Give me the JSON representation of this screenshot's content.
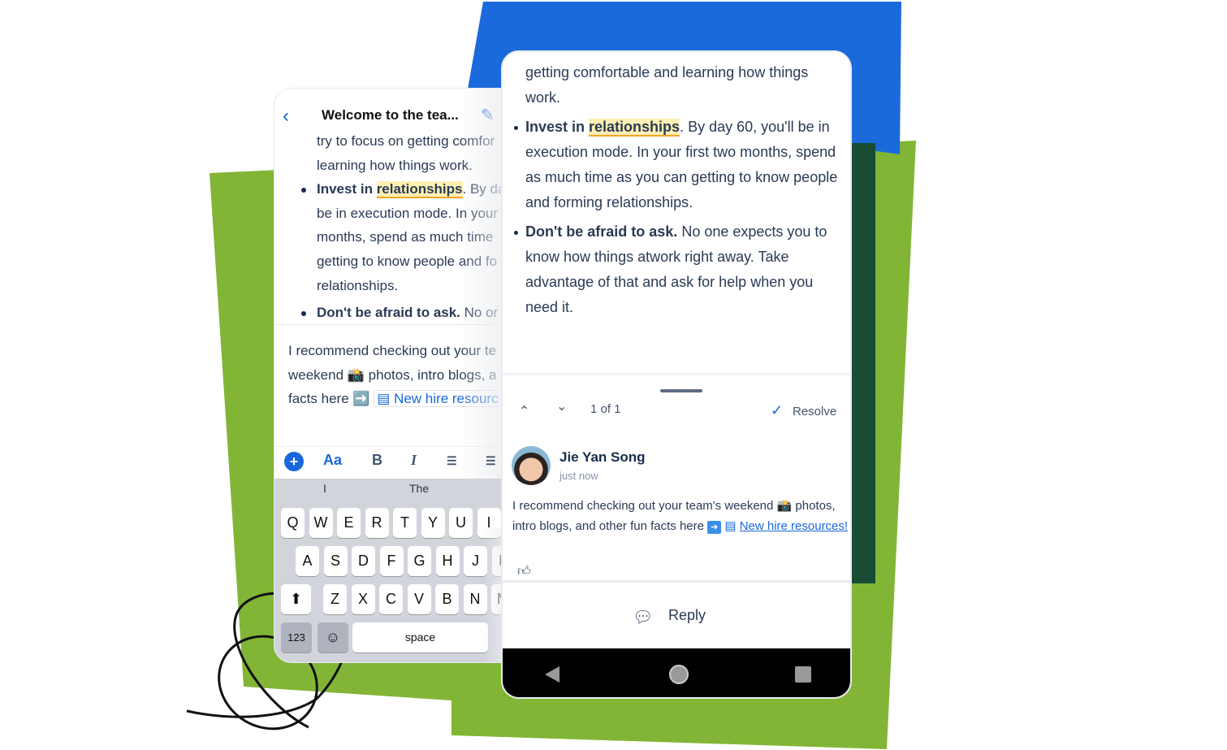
{
  "colors": {
    "blue": "#1a6adb",
    "green": "#82b536",
    "dark_green": "#174d35",
    "accent": "#1868db",
    "highlight": "#fff0b3"
  },
  "left_phone": {
    "header": {
      "title": "Welcome to the tea...",
      "back_icon": "chevron-left-icon",
      "edit_icon": "pencil-icon"
    },
    "doc": {
      "line1": "try to focus on getting comfor",
      "line2": "learning how things work.",
      "b1_bold": "Invest in ",
      "b1_hl": "relationships",
      "b1_rest": ". By da",
      "l3": "be in execution mode. In your",
      "l4": "months, spend as much time",
      "l5": "getting to know people and fo",
      "l6": "relationships.",
      "b2_bold": "Don't be afraid to ask.",
      "b2_rest": " No or"
    },
    "comment": {
      "line1": "I recommend checking out your te",
      "line2a": "weekend ",
      "line2b": " photos, intro blogs, a",
      "line3": "facts here ",
      "link": "New hire resourc"
    },
    "toolbar": {
      "add": "+",
      "text_style": "Aa",
      "bold": "B",
      "italic": "I",
      "bullet": "☰",
      "numbered": "☰"
    },
    "keyboard": {
      "suggestions": [
        "I",
        "The"
      ],
      "row1": [
        "Q",
        "W",
        "E",
        "R",
        "T",
        "Y",
        "U",
        "I"
      ],
      "row2": [
        "A",
        "S",
        "D",
        "F",
        "G",
        "H",
        "J",
        "K"
      ],
      "row3": [
        "Z",
        "X",
        "C",
        "V",
        "B",
        "N",
        "M"
      ],
      "numbers": "123",
      "space": "space"
    }
  },
  "right_phone": {
    "doc": {
      "l1": "getting comfortable and learning how things",
      "l2": "work.",
      "b1_bold": "Invest in ",
      "b1_hl": "relationships",
      "b1_rest": ". By day 60, you'll be in",
      "l3": "execution mode. In your first two months, spend",
      "l4": "as much time as you can getting to know people",
      "l5": "and forming relationships.",
      "b2_bold": "Don't be afraid to ask.",
      "b2_rest": " No one expects you to",
      "l6": "know how things atwork right away. Take",
      "l7": "advantage of that and ask for help when you",
      "l8": "need it."
    },
    "comments": {
      "counter": "1 of 1",
      "resolve": "Resolve",
      "author": "Jie Yan Song",
      "time": "just now",
      "text1": "I recommend checking out your team's weekend ",
      "text2": " photos, intro blogs, and other fun facts here ",
      "link": "New hire resources!",
      "reply": "Reply"
    }
  }
}
